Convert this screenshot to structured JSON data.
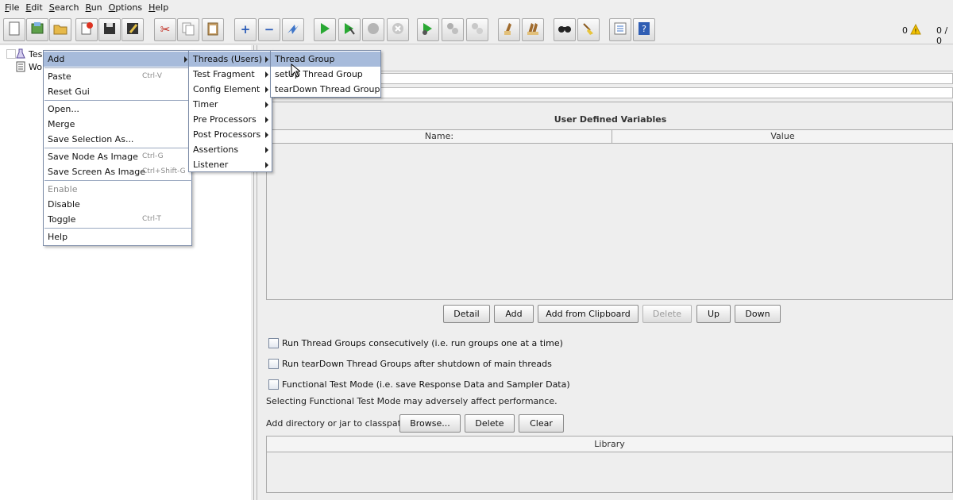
{
  "menubar": [
    "File",
    "Edit",
    "Search",
    "Run",
    "Options",
    "Help"
  ],
  "toolbar": {
    "icons": [
      "new-icon",
      "templates-icon",
      "open-icon",
      "close-icon",
      "save-icon",
      "save-as-icon",
      "cut-icon",
      "copy-icon",
      "paste-icon",
      "expand-icon",
      "collapse-icon",
      "toggle-icon",
      "start-icon",
      "start-no-pause-icon",
      "stop-icon",
      "shutdown-icon",
      "remote-start-icon",
      "remote-stop-icon",
      "remote-shutdown-icon",
      "clear-icon",
      "clear-all-icon",
      "search-icon",
      "reset-search-icon",
      "function-helper-icon",
      "help-icon"
    ],
    "warn_count": "0",
    "threads_count": "0 / 0"
  },
  "tree": {
    "items": [
      "Tes",
      "Wo"
    ]
  },
  "context_menu": {
    "items": [
      {
        "label": "Add",
        "shortcut": "",
        "submenu": true,
        "selected": true,
        "disabled": false
      },
      {
        "label": "Paste",
        "shortcut": "Ctrl-V",
        "submenu": false,
        "selected": false,
        "disabled": false
      },
      {
        "label": "Reset Gui",
        "shortcut": "",
        "submenu": false,
        "selected": false,
        "disabled": false
      },
      {
        "label": "Open...",
        "shortcut": "",
        "submenu": false,
        "selected": false,
        "disabled": false
      },
      {
        "label": "Merge",
        "shortcut": "",
        "submenu": false,
        "selected": false,
        "disabled": false
      },
      {
        "label": "Save Selection As...",
        "shortcut": "",
        "submenu": false,
        "selected": false,
        "disabled": false
      },
      {
        "label": "Save Node As Image",
        "shortcut": "Ctrl-G",
        "submenu": false,
        "selected": false,
        "disabled": false
      },
      {
        "label": "Save Screen As Image",
        "shortcut": "Ctrl+Shift-G",
        "submenu": false,
        "selected": false,
        "disabled": false
      },
      {
        "label": "Enable",
        "shortcut": "",
        "submenu": false,
        "selected": false,
        "disabled": true
      },
      {
        "label": "Disable",
        "shortcut": "",
        "submenu": false,
        "selected": false,
        "disabled": false
      },
      {
        "label": "Toggle",
        "shortcut": "Ctrl-T",
        "submenu": false,
        "selected": false,
        "disabled": false
      },
      {
        "label": "Help",
        "shortcut": "",
        "submenu": false,
        "selected": false,
        "disabled": false
      }
    ]
  },
  "add_submenu": {
    "items": [
      {
        "label": "Threads (Users)",
        "selected": true
      },
      {
        "label": "Test Fragment",
        "selected": false
      },
      {
        "label": "Config Element",
        "selected": false
      },
      {
        "label": "Timer",
        "selected": false
      },
      {
        "label": "Pre Processors",
        "selected": false
      },
      {
        "label": "Post Processors",
        "selected": false
      },
      {
        "label": "Assertions",
        "selected": false
      },
      {
        "label": "Listener",
        "selected": false
      }
    ]
  },
  "threads_submenu": {
    "items": [
      {
        "label": "Thread Group",
        "selected": true
      },
      {
        "label": "setUp Thread Group",
        "selected": false
      },
      {
        "label": "tearDown Thread Group",
        "selected": false
      }
    ]
  },
  "test_plan": {
    "udv_title": "User Defined Variables",
    "col_name": "Name:",
    "col_value": "Value",
    "buttons": {
      "detail": "Detail",
      "add": "Add",
      "add_clipboard": "Add from Clipboard",
      "delete": "Delete",
      "up": "Up",
      "down": "Down"
    },
    "checkbox_consecutive": "Run Thread Groups consecutively (i.e. run groups one at a time)",
    "checkbox_teardown": "Run tearDown Thread Groups after shutdown of main threads",
    "checkbox_functional": "Functional Test Mode (i.e. save Response Data and Sampler Data)",
    "functional_note": "Selecting Functional Test Mode may adversely affect performance.",
    "classpath_label": "Add directory or jar to classpath",
    "browse": "Browse...",
    "cp_delete": "Delete",
    "clear": "Clear",
    "library_header": "Library"
  },
  "colors": {
    "selection": "#a7bbdb",
    "menu_border": "#7a8aa6",
    "warn": "#f2c100"
  }
}
